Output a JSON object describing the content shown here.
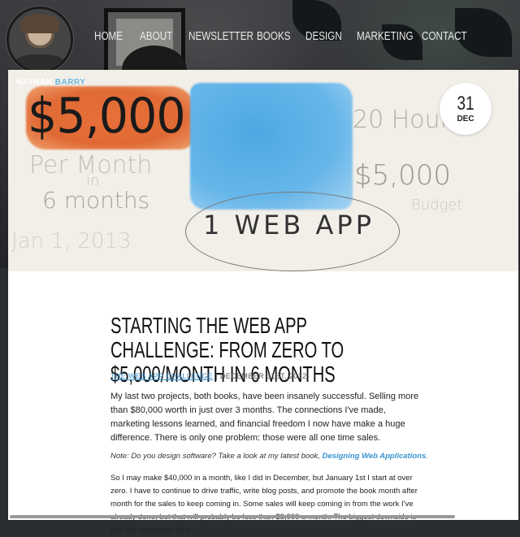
{
  "site": {
    "name_first": "NATHAN",
    "name_last": "BARRY"
  },
  "nav": {
    "items": [
      "HOME",
      "ABOUT",
      "NEWSLETTER",
      "BOOKS",
      "DESIGN",
      "MARKETING",
      "CONTACT"
    ]
  },
  "feature_image": {
    "headline": "$5,000",
    "per_month": "Per Month",
    "in": "in",
    "six_months": "6 months",
    "date": "Jan 1, 2013",
    "hours": "20 Hours",
    "budget_amount": "$5,000",
    "budget_label": "Budget",
    "web_app": "1 WEB APP",
    "accent_orange": "#e8703a",
    "accent_blue": "#4fa8e2"
  },
  "date_badge": {
    "day": "31",
    "month": "DEC"
  },
  "article": {
    "title": "Starting the Web App Challenge: From Zero to $5,000/month in 6 months",
    "category": "THE WEB APP CHALLENGE",
    "date": "DECEMBER 31ST, 2012",
    "paragraph1": "My last two projects, both books, have been insanely successful. Selling more than $80,000 worth in just over 3 months. The connections I've made, marketing lessons learned, and financial freedom I now have make a huge difference. There is  only one problem: those were all one time sales.",
    "note_prefix": "Note: Do you design software? Take a look at my latest book,",
    "note_link": "Designing Web Applications",
    "note_suffix": ".",
    "paragraph2": "So I may make $40,000 in a month, like I did in December, but January 1st I start at over zero. I have to continue to drive traffic, write blog posts, and promote the book month after month for the sales to keep coming in. Some sales will keep coming in from the work I've already done, but that will probably be less than $3,000 a month. The biggest downside is that the customers who"
  }
}
